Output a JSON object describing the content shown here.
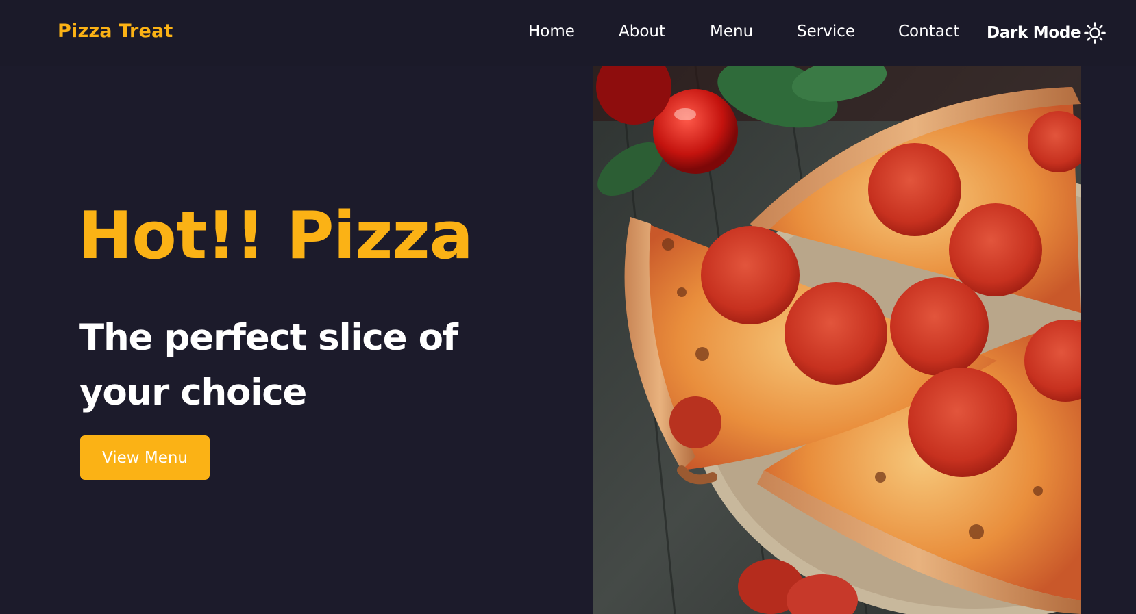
{
  "brand": {
    "name": "Pizza Treat"
  },
  "nav": {
    "items": [
      {
        "label": "Home"
      },
      {
        "label": "About"
      },
      {
        "label": "Menu"
      },
      {
        "label": "Service"
      },
      {
        "label": "Contact"
      }
    ],
    "dark_mode_label": "Dark Mode",
    "dark_mode_icon": "sun-icon"
  },
  "hero": {
    "title": "Hot!! Pizza",
    "subtitle": "The perfect slice of your choice",
    "cta_label": "View Menu",
    "image_icon": "pepperoni-pizza-photo"
  },
  "colors": {
    "background": "#1c1b2b",
    "accent": "#fbb215",
    "text": "#ffffff"
  }
}
